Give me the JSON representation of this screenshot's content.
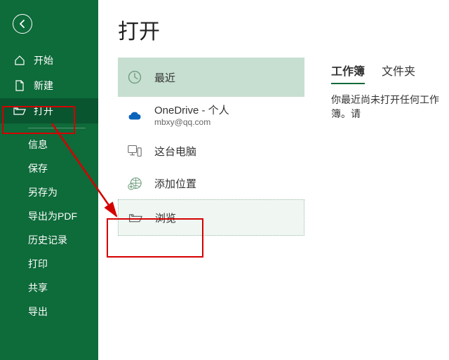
{
  "sidebar": {
    "items": [
      {
        "label": "开始"
      },
      {
        "label": "新建"
      },
      {
        "label": "打开"
      }
    ],
    "sub_items": [
      {
        "label": "信息"
      },
      {
        "label": "保存"
      },
      {
        "label": "另存为"
      },
      {
        "label": "导出为PDF"
      },
      {
        "label": "历史记录"
      },
      {
        "label": "打印"
      },
      {
        "label": "共享"
      },
      {
        "label": "导出"
      }
    ]
  },
  "main": {
    "title": "打开",
    "sources": {
      "recent": "最近",
      "onedrive_title": "OneDrive - 个人",
      "onedrive_sub": "mbxy@qq.com",
      "this_pc": "这台电脑",
      "add_place": "添加位置",
      "browse": "浏览"
    },
    "tabs": {
      "workbooks": "工作簿",
      "folders": "文件夹"
    },
    "empty_message": "你最近尚未打开任何工作簿。请"
  },
  "colors": {
    "brand": "#0e6b3a",
    "highlight": "#d40000"
  }
}
